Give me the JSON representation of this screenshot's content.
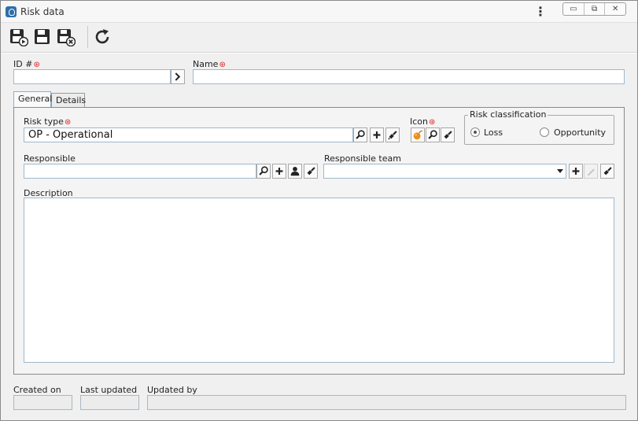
{
  "window": {
    "title": "Risk data",
    "kebab": "⋮",
    "controls": [
      "▭",
      "⧉",
      "✕"
    ]
  },
  "toolbar": {
    "buttons": [
      "save-and-new",
      "save",
      "save-and-close",
      "refresh"
    ]
  },
  "form": {
    "id": {
      "label": "ID #",
      "value": ""
    },
    "name": {
      "label": "Name",
      "value": ""
    },
    "required_mark": "⊛"
  },
  "tabs": [
    {
      "label": "General",
      "active": true
    },
    {
      "label": "Details",
      "active": false
    }
  ],
  "general": {
    "risk_type": {
      "label": "Risk type",
      "value": "OP - Operational"
    },
    "icon": {
      "label": "Icon"
    },
    "risk_classification": {
      "legend": "Risk classification",
      "options": [
        "Loss",
        "Opportunity"
      ],
      "selected": "Loss"
    },
    "responsible": {
      "label": "Responsible",
      "value": ""
    },
    "responsible_team": {
      "label": "Responsible team",
      "value": ""
    },
    "description": {
      "label": "Description",
      "value": ""
    }
  },
  "footer": {
    "created_on": {
      "label": "Created on",
      "value": ""
    },
    "last_updated": {
      "label": "Last updated",
      "value": ""
    },
    "updated_by": {
      "label": "Updated by",
      "value": ""
    }
  },
  "colors": {
    "accent": "#2f6fa8",
    "required": "#e02020",
    "input_border": "#9fb8cc",
    "icon_orange": "#f08c1a"
  }
}
